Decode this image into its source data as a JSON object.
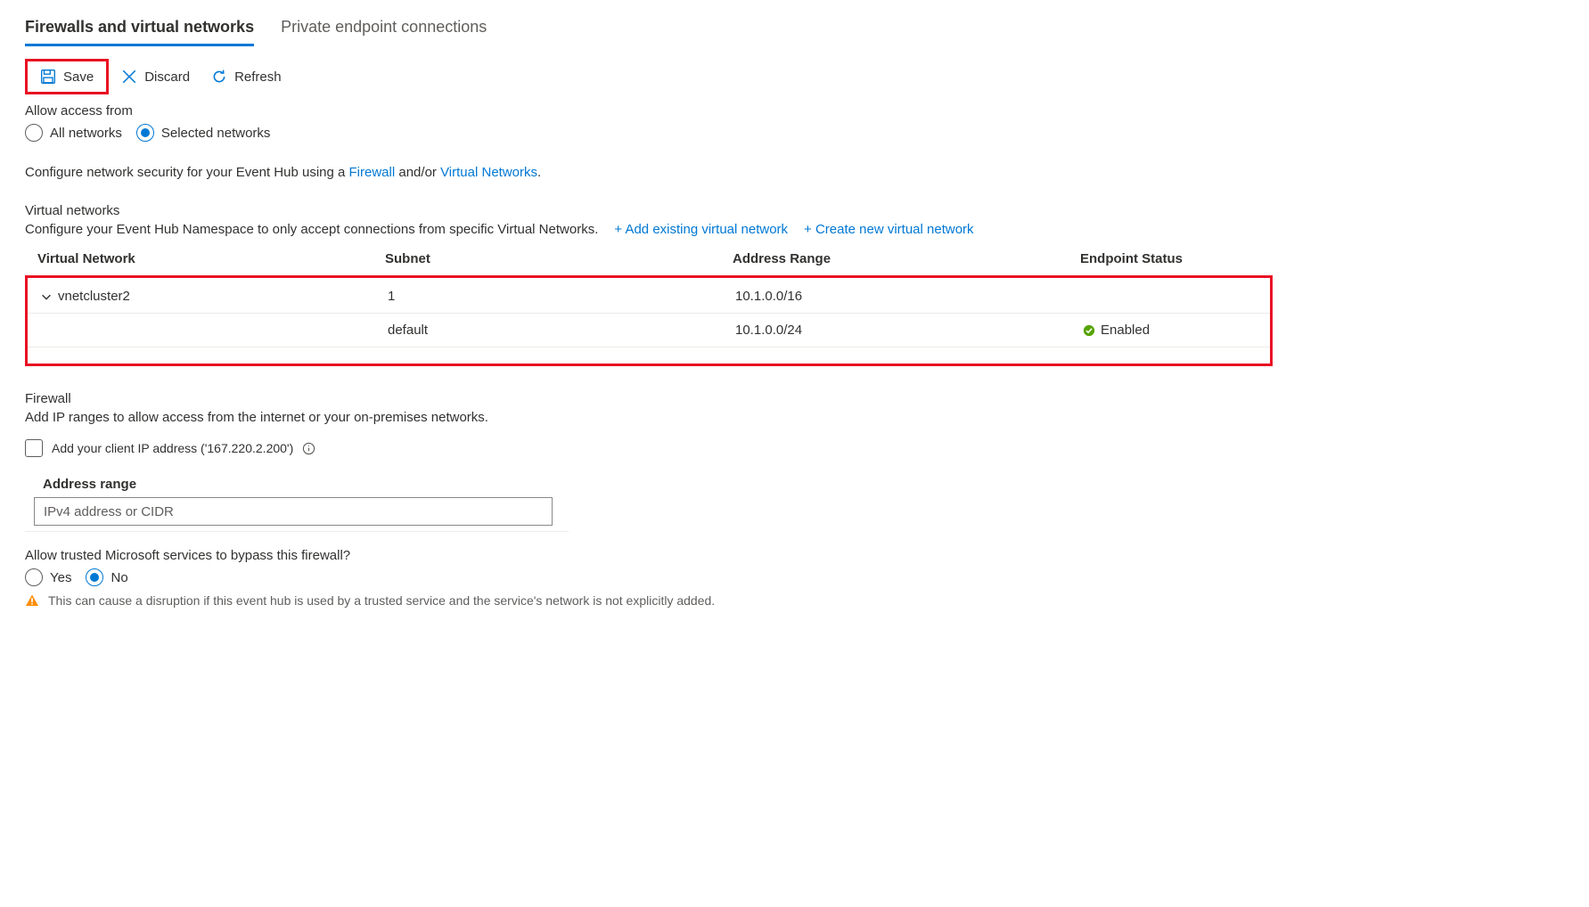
{
  "tabs": {
    "firewalls": "Firewalls and virtual networks",
    "private": "Private endpoint connections"
  },
  "toolbar": {
    "save": "Save",
    "discard": "Discard",
    "refresh": "Refresh"
  },
  "access": {
    "label": "Allow access from",
    "all": "All networks",
    "selected": "Selected networks"
  },
  "configure_line": {
    "pre": "Configure network security for your Event Hub using a ",
    "firewall": "Firewall",
    "andor": " and/or ",
    "vnets": "Virtual Networks",
    "end": "."
  },
  "vnet": {
    "header": "Virtual networks",
    "sub": "Configure your Event Hub Namespace to only accept connections from specific Virtual Networks.",
    "add_existing": "+ Add existing virtual network",
    "create_new": "+ Create new virtual network",
    "cols": {
      "c1": "Virtual Network",
      "c2": "Subnet",
      "c3": "Address Range",
      "c4": "Endpoint Status"
    },
    "rows": [
      {
        "name": "vnetcluster2",
        "subnet": "1",
        "range": "10.1.0.0/16",
        "status": ""
      },
      {
        "name": "",
        "subnet": "default",
        "range": "10.1.0.0/24",
        "status": "Enabled"
      }
    ]
  },
  "firewall": {
    "header": "Firewall",
    "sub": "Add IP ranges to allow access from the internet or your on-premises networks.",
    "add_client": "Add your client IP address ('167.220.2.200')",
    "col_head": "Address range",
    "placeholder": "IPv4 address or CIDR"
  },
  "trusted": {
    "label": "Allow trusted Microsoft services to bypass this firewall?",
    "yes": "Yes",
    "no": "No",
    "warning": "This can cause a disruption if this event hub is used by a trusted service and the service's network is not explicitly added."
  }
}
